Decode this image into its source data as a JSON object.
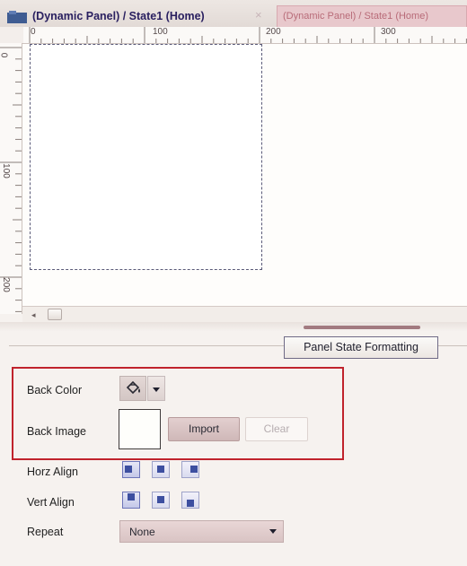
{
  "tabs": [
    {
      "label": "(Dynamic Panel) / State1 (Home)",
      "close": "×",
      "active": true
    },
    {
      "label": "(Dynamic Panel) / State1 (Home)",
      "active": false
    }
  ],
  "ruler": {
    "horizontal_labels": [
      "0",
      "100",
      "200",
      "300"
    ],
    "vertical_labels": [
      "0",
      "100",
      "200"
    ]
  },
  "format_panel": {
    "tab_label": "Panel State Formatting",
    "back_color_label": "Back Color",
    "back_image_label": "Back Image",
    "import_label": "Import",
    "clear_label": "Clear",
    "horz_align_label": "Horz Align",
    "vert_align_label": "Vert Align",
    "repeat_label": "Repeat",
    "repeat_value": "None"
  },
  "icons": {
    "tab": "panel-tab-icon",
    "fill": "paint-bucket-icon",
    "dropdown": "chevron-down-icon",
    "scroll_left": "scroll-left-arrow-icon"
  },
  "colors": {
    "highlight": "#c0232c",
    "active_tab_text": "#2a2060",
    "inactive_tab_text": "#b86b78"
  }
}
